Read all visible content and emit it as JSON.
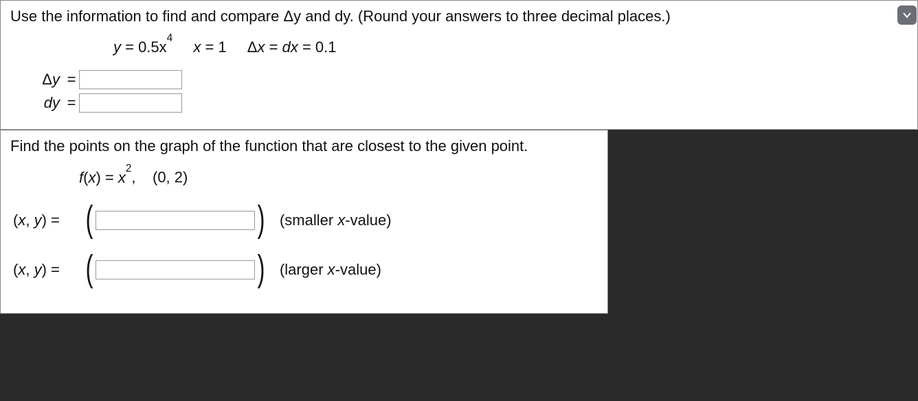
{
  "problem1": {
    "instructions": "Use the information to find and compare Δy and dy. (Round your answers to three decimal places.)",
    "eq_y_prefix": "y",
    "eq_y_value": " = 0.5x",
    "eq_y_exp": "4",
    "eq_x": "x = 1",
    "eq_dx": "Δx = dx = 0.1",
    "label_dy_cap": "Δy",
    "label_dy": "dy",
    "equals": "="
  },
  "problem2": {
    "instructions": "Find the points on the graph of the function that are closest to the given point.",
    "func_prefix": "f(x) = x",
    "func_exp": "2",
    "func_sep": ",",
    "point": "(0, 2)",
    "xy_label_open": "(",
    "xy_label_x": "x",
    "xy_label_sep": ", ",
    "xy_label_y": "y",
    "xy_label_close": ")",
    "equals": " = ",
    "paren_open": "(",
    "paren_close": ")",
    "hint_smaller": "(smaller x-value)",
    "hint_larger": "(larger x-value)"
  }
}
